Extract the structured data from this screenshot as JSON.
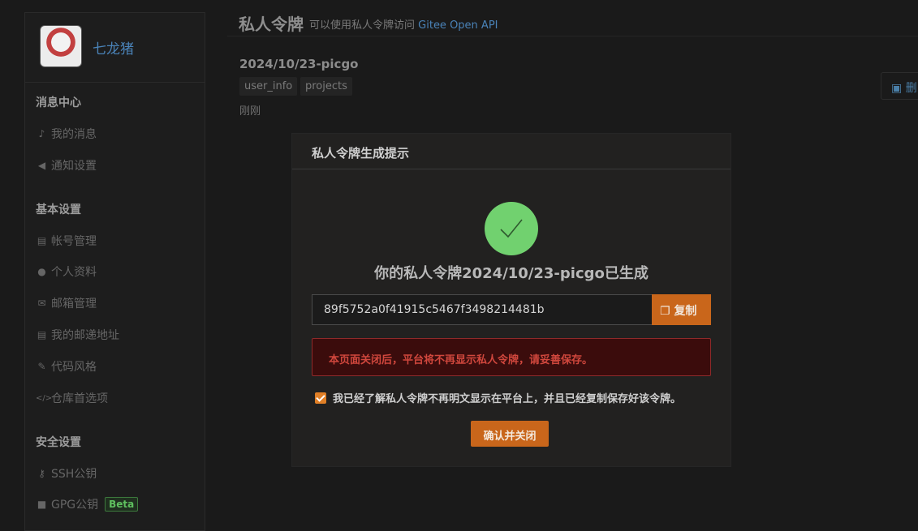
{
  "sidebar": {
    "username": "七龙猪",
    "sections": [
      {
        "title": "消息中心",
        "items": [
          {
            "icon": "bell-icon",
            "glyph": "🔔",
            "label": "我的消息"
          },
          {
            "icon": "megaphone-icon",
            "glyph": "📢",
            "label": "通知设置"
          }
        ]
      },
      {
        "title": "基本设置",
        "items": [
          {
            "icon": "id-card-icon",
            "glyph": "▤",
            "label": "帐号管理"
          },
          {
            "icon": "user-icon",
            "glyph": "●",
            "label": "个人资料"
          },
          {
            "icon": "envelope-icon",
            "glyph": "✉",
            "label": "邮箱管理"
          },
          {
            "icon": "address-card-icon",
            "glyph": "▤",
            "label": "我的邮递地址"
          },
          {
            "icon": "brush-icon",
            "glyph": "✎",
            "label": "代码风格"
          },
          {
            "icon": "code-icon",
            "glyph": "</>",
            "label": "仓库首选项"
          }
        ]
      },
      {
        "title": "安全设置",
        "items": [
          {
            "icon": "key-icon",
            "glyph": "⚷",
            "label": "SSH公钥"
          },
          {
            "icon": "lock-icon",
            "glyph": "🔒",
            "label": "GPG公钥",
            "badge": "Beta"
          }
        ]
      }
    ]
  },
  "header": {
    "title": "私人令牌",
    "subtitle_prefix": "可以使用私人令牌访问",
    "subtitle_link": "Gitee Open API"
  },
  "token": {
    "name": "2024/10/23-picgo",
    "scopes": [
      "user_info",
      "projects"
    ],
    "time": "刚刚",
    "delete_label": "删"
  },
  "modal": {
    "title": "私人令牌生成提示",
    "message": "你的私人令牌2024/10/23-picgo已生成",
    "token_value": "89f5752a0f41915c5467f3498214481b",
    "copy_label": "复制",
    "warning": "本页面关闭后，平台将不再显示私人令牌，请妥善保存。",
    "agree_text": "我已经了解私人令牌不再明文显示在平台上，并且已经复制保存好该令牌。",
    "agree_checked": true,
    "confirm_label": "确认并关闭"
  },
  "colors": {
    "accent": "#c9661b",
    "success": "#71d16f",
    "link": "#4a83b8",
    "danger": "#d0473d"
  }
}
